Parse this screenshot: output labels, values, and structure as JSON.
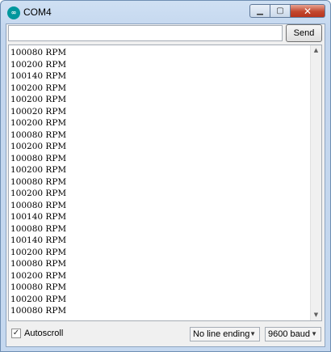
{
  "window": {
    "title": "COM4"
  },
  "app_icon": {
    "glyph": "∞",
    "color": "#00979d"
  },
  "controls": {
    "minimize": "▁",
    "maximize": "▢",
    "close": "✕"
  },
  "toolbar": {
    "send_input_value": "",
    "send_label": "Send"
  },
  "output": {
    "lines": [
      "100080 RPM",
      "100200 RPM",
      "100140 RPM",
      "100200 RPM",
      "100200 RPM",
      "100020 RPM",
      "100200 RPM",
      "100080 RPM",
      "100200 RPM",
      "100080 RPM",
      "100200 RPM",
      "100080 RPM",
      "100200 RPM",
      "100080 RPM",
      "100140 RPM",
      "100080 RPM",
      "100140 RPM",
      "100200 RPM",
      "100080 RPM",
      "100200 RPM",
      "100080 RPM",
      "100200 RPM",
      "100080 RPM"
    ]
  },
  "footer": {
    "autoscroll_label": "Autoscroll",
    "autoscroll_checked": true,
    "line_ending": "No line ending",
    "baud": "9600 baud"
  }
}
